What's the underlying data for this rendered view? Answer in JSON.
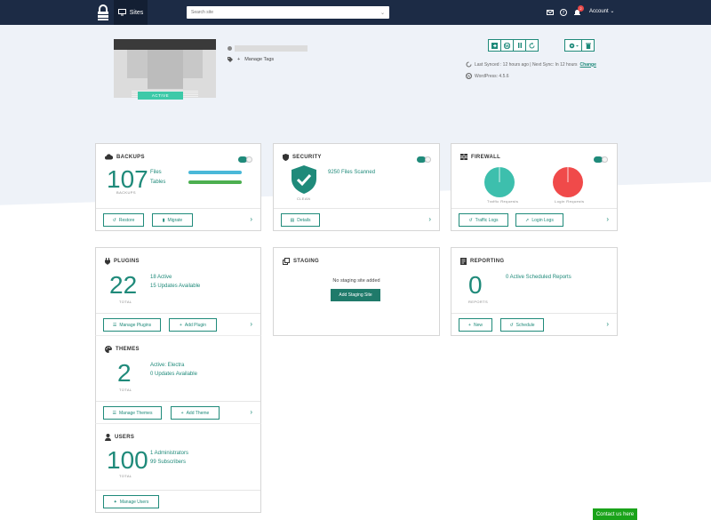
{
  "topbar": {
    "sites_label": "Sites",
    "search_placeholder": "Search site",
    "account_label": "Account",
    "notification_count": "2"
  },
  "site": {
    "status": "ACTIVE",
    "manage_tags": "Manage Tags",
    "last_synced": "Last Synced : 12 hours ago | Next Sync: In 12 hours",
    "change_link": "Change",
    "wordpress": "WordPress: 4.5.6"
  },
  "backups": {
    "title": "BACKUPS",
    "count": "107",
    "count_label": "BACKUPS",
    "files_label": "Files",
    "tables_label": "Tables",
    "files_color": "#4ab8d8",
    "tables_color": "#4caf50",
    "restore_label": "Restore",
    "migrate_label": "Migrate"
  },
  "security": {
    "title": "SECURITY",
    "files_scanned": "9250 Files Scanned",
    "shield_label": "CLEAN",
    "details_label": "Details"
  },
  "firewall": {
    "title": "FIREWALL",
    "traffic_label": "Traffic Requests",
    "login_label": "Login Requests",
    "traffic_color": "#3dbfad",
    "login_color": "#f04a4a",
    "traffic_logs_label": "Traffic Logs",
    "login_logs_label": "Login Logs"
  },
  "plugins": {
    "title": "PLUGINS",
    "count": "22",
    "count_label": "TOTAL",
    "active": "18 Active",
    "updates": "15 Updates Available",
    "manage_label": "Manage Plugins",
    "add_label": "Add Plugin"
  },
  "staging": {
    "title": "STAGING",
    "empty_text": "No staging site added",
    "add_label": "Add Staging Site"
  },
  "reporting": {
    "title": "REPORTING",
    "count": "0",
    "count_label": "REPORTS",
    "scheduled": "0 Active Scheduled Reports",
    "new_label": "New",
    "schedule_label": "Schedule"
  },
  "themes": {
    "title": "THEMES",
    "count": "2",
    "count_label": "TOTAL",
    "active": "Active: Electra",
    "updates": "0 Updates Available",
    "manage_label": "Manage Themes",
    "add_label": "Add Theme"
  },
  "users": {
    "title": "USERS",
    "count": "100",
    "count_label": "TOTAL",
    "admins": "1 Administrators",
    "subscribers": "99 Subscribers",
    "manage_label": "Manage Users"
  },
  "contact_label": "Contact us here",
  "colors": {
    "accent": "#1f8a7a",
    "topbar": "#1c2b45"
  }
}
